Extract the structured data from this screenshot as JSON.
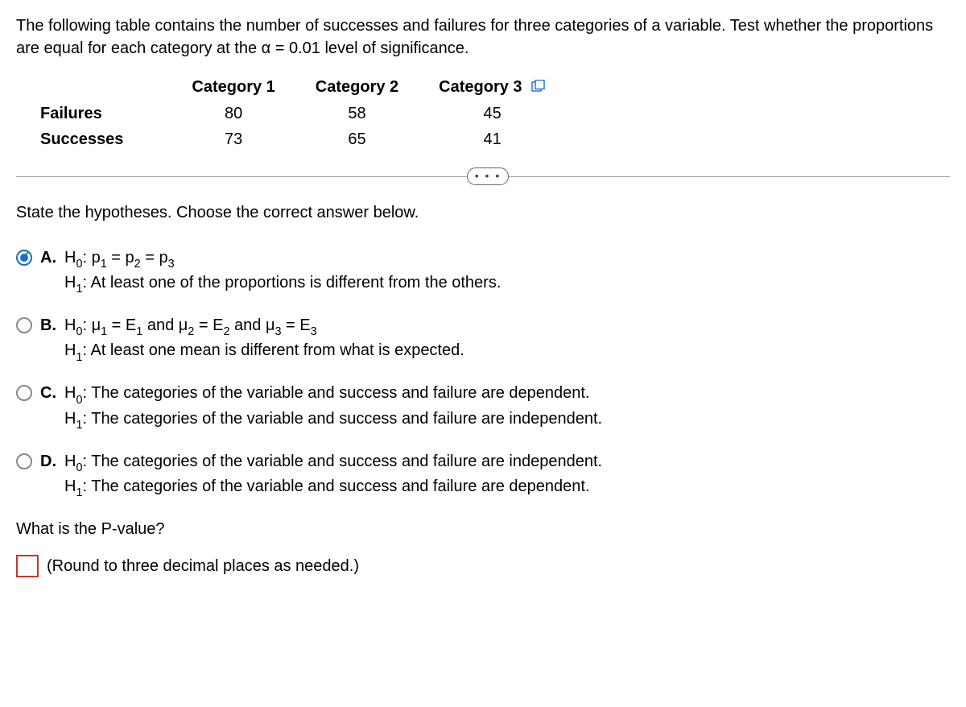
{
  "intro": "The following table contains the number of successes and failures for three categories of a variable. Test whether the proportions are equal for each category at the α = 0.01 level of significance.",
  "table": {
    "headers": [
      "",
      "Category 1",
      "Category 2",
      "Category 3"
    ],
    "rows": [
      {
        "label": "Failures",
        "values": [
          "80",
          "58",
          "45"
        ]
      },
      {
        "label": "Successes",
        "values": [
          "73",
          "65",
          "41"
        ]
      }
    ]
  },
  "ellipsis": "• • •",
  "prompt": "State the hypotheses. Choose the correct answer below.",
  "options": {
    "A": {
      "h0_pre": "H",
      "h0_sub": "0",
      "h0_post": ": p",
      "h0_p1s": "1",
      "h0_mid1": " = p",
      "h0_p2s": "2",
      "h0_mid2": " = p",
      "h0_p3s": "3",
      "h1_pre": "H",
      "h1_sub": "1",
      "h1_post": ": At least one of the proportions is different from the others."
    },
    "B": {
      "h0_pre": "H",
      "h0_sub": "0",
      "h0_post": ": μ",
      "b_m1s": "1",
      "b_eq1": " = E",
      "b_e1s": "1",
      "b_and1": " and μ",
      "b_m2s": "2",
      "b_eq2": " = E",
      "b_e2s": "2",
      "b_and2": " and μ",
      "b_m3s": "3",
      "b_eq3": " = E",
      "b_e3s": "3",
      "h1_pre": "H",
      "h1_sub": "1",
      "h1_post": ": At least one mean is different from what is expected."
    },
    "C": {
      "h0_pre": "H",
      "h0_sub": "0",
      "h0_post": ": The categories of the variable and success and failure are dependent.",
      "h1_pre": "H",
      "h1_sub": "1",
      "h1_post": ": The categories of the variable and success and failure are independent."
    },
    "D": {
      "h0_pre": "H",
      "h0_sub": "0",
      "h0_post": ": The categories of the variable and success and failure are independent.",
      "h1_pre": "H",
      "h1_sub": "1",
      "h1_post": ": The categories of the variable and success and failure are dependent."
    }
  },
  "letters": {
    "A": "A.",
    "B": "B.",
    "C": "C.",
    "D": "D."
  },
  "pvalue_question": "What is the P-value?",
  "pvalue_hint": "(Round to three decimal places as needed.)",
  "pvalue_input": ""
}
